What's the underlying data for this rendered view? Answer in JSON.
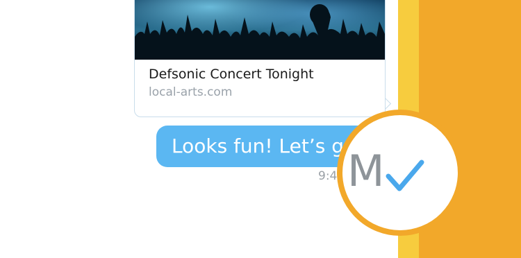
{
  "link_preview": {
    "title": "Defsonic Concert Tonight",
    "domain": "local-arts.com",
    "image": "concert-crowd-image"
  },
  "message": {
    "text": "Looks fun! Let’s go",
    "time": "9:4",
    "magnified_time_fragment": "M",
    "status_icon": "checkmark-icon"
  },
  "colors": {
    "bubble": "#5BB7F2",
    "accent_yellow": "#F7CC3E",
    "accent_orange": "#F2A82A",
    "check": "#4AA8EC"
  }
}
